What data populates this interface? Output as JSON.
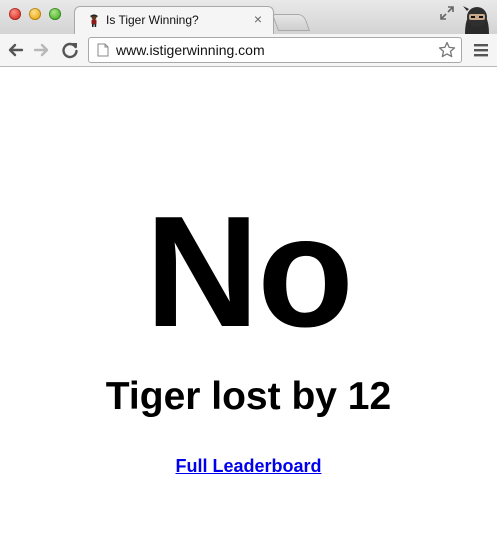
{
  "browser": {
    "tab": {
      "title": "Is Tiger Winning?",
      "close_symbol": "×",
      "favicon": "tiger-golfer-favicon"
    },
    "address_bar": {
      "url": "www.istigerwinning.com"
    },
    "icons": {
      "back": "back-arrow-icon",
      "forward": "forward-arrow-icon",
      "reload": "reload-icon",
      "star": "bookmark-star-icon",
      "menu": "hamburger-menu-icon",
      "fullscreen": "fullscreen-icon",
      "profile": "ninja-avatar-icon"
    }
  },
  "page": {
    "answer": "No",
    "subtitle": "Tiger lost by 12",
    "link_label": "Full Leaderboard",
    "link_color": "#0000ee"
  }
}
